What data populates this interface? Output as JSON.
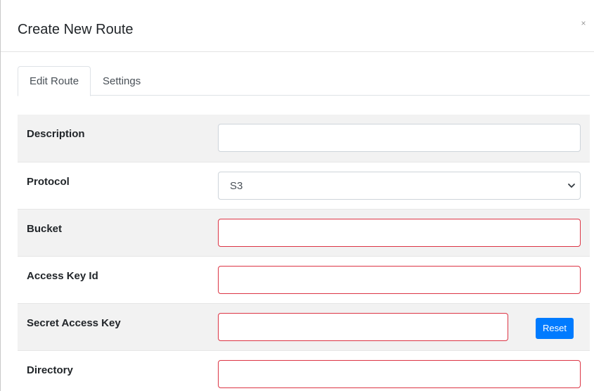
{
  "dialog": {
    "title": "Create New Route",
    "close_label": "×"
  },
  "tabs": [
    {
      "label": "Edit Route",
      "active": true
    },
    {
      "label": "Settings",
      "active": false
    }
  ],
  "form": {
    "description": {
      "label": "Description",
      "value": "",
      "invalid": false
    },
    "protocol": {
      "label": "Protocol",
      "value": "S3"
    },
    "bucket": {
      "label": "Bucket",
      "value": "",
      "invalid": true
    },
    "access_key_id": {
      "label": "Access Key Id",
      "value": "",
      "invalid": true
    },
    "secret_access_key": {
      "label": "Secret Access Key",
      "value": "",
      "invalid": true,
      "reset_label": "Reset"
    },
    "directory": {
      "label": "Directory",
      "value": "",
      "invalid": true
    }
  },
  "colors": {
    "invalid_border": "#dc3545",
    "primary_button": "#007bff",
    "row_shade": "#f2f2f2"
  },
  "icons": {
    "close": "close-icon",
    "select_chevron": "chevron-down-icon"
  }
}
